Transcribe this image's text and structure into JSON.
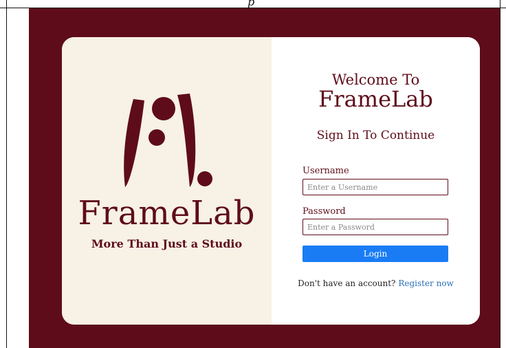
{
  "colors": {
    "brand": "#5e0c1a",
    "cream": "#f7f1e6",
    "accent_button": "#1a7cf5",
    "link": "#2a6fb5"
  },
  "document": {
    "caption_fragment": "p"
  },
  "brand_panel": {
    "logo_icon": "framelab-logo-icon",
    "name": "FrameLab",
    "tagline": "More Than Just a Studio"
  },
  "login_form": {
    "welcome_line": "Welcome To",
    "welcome_brand": "FrameLab",
    "subtitle": "Sign In To Continue",
    "username": {
      "label": "Username",
      "placeholder": "Enter a Username",
      "value": ""
    },
    "password": {
      "label": "Password",
      "placeholder": "Enter a Password",
      "value": ""
    },
    "login_label": "Login",
    "register_prompt": "Don't have an account?",
    "register_link": "Register now"
  }
}
